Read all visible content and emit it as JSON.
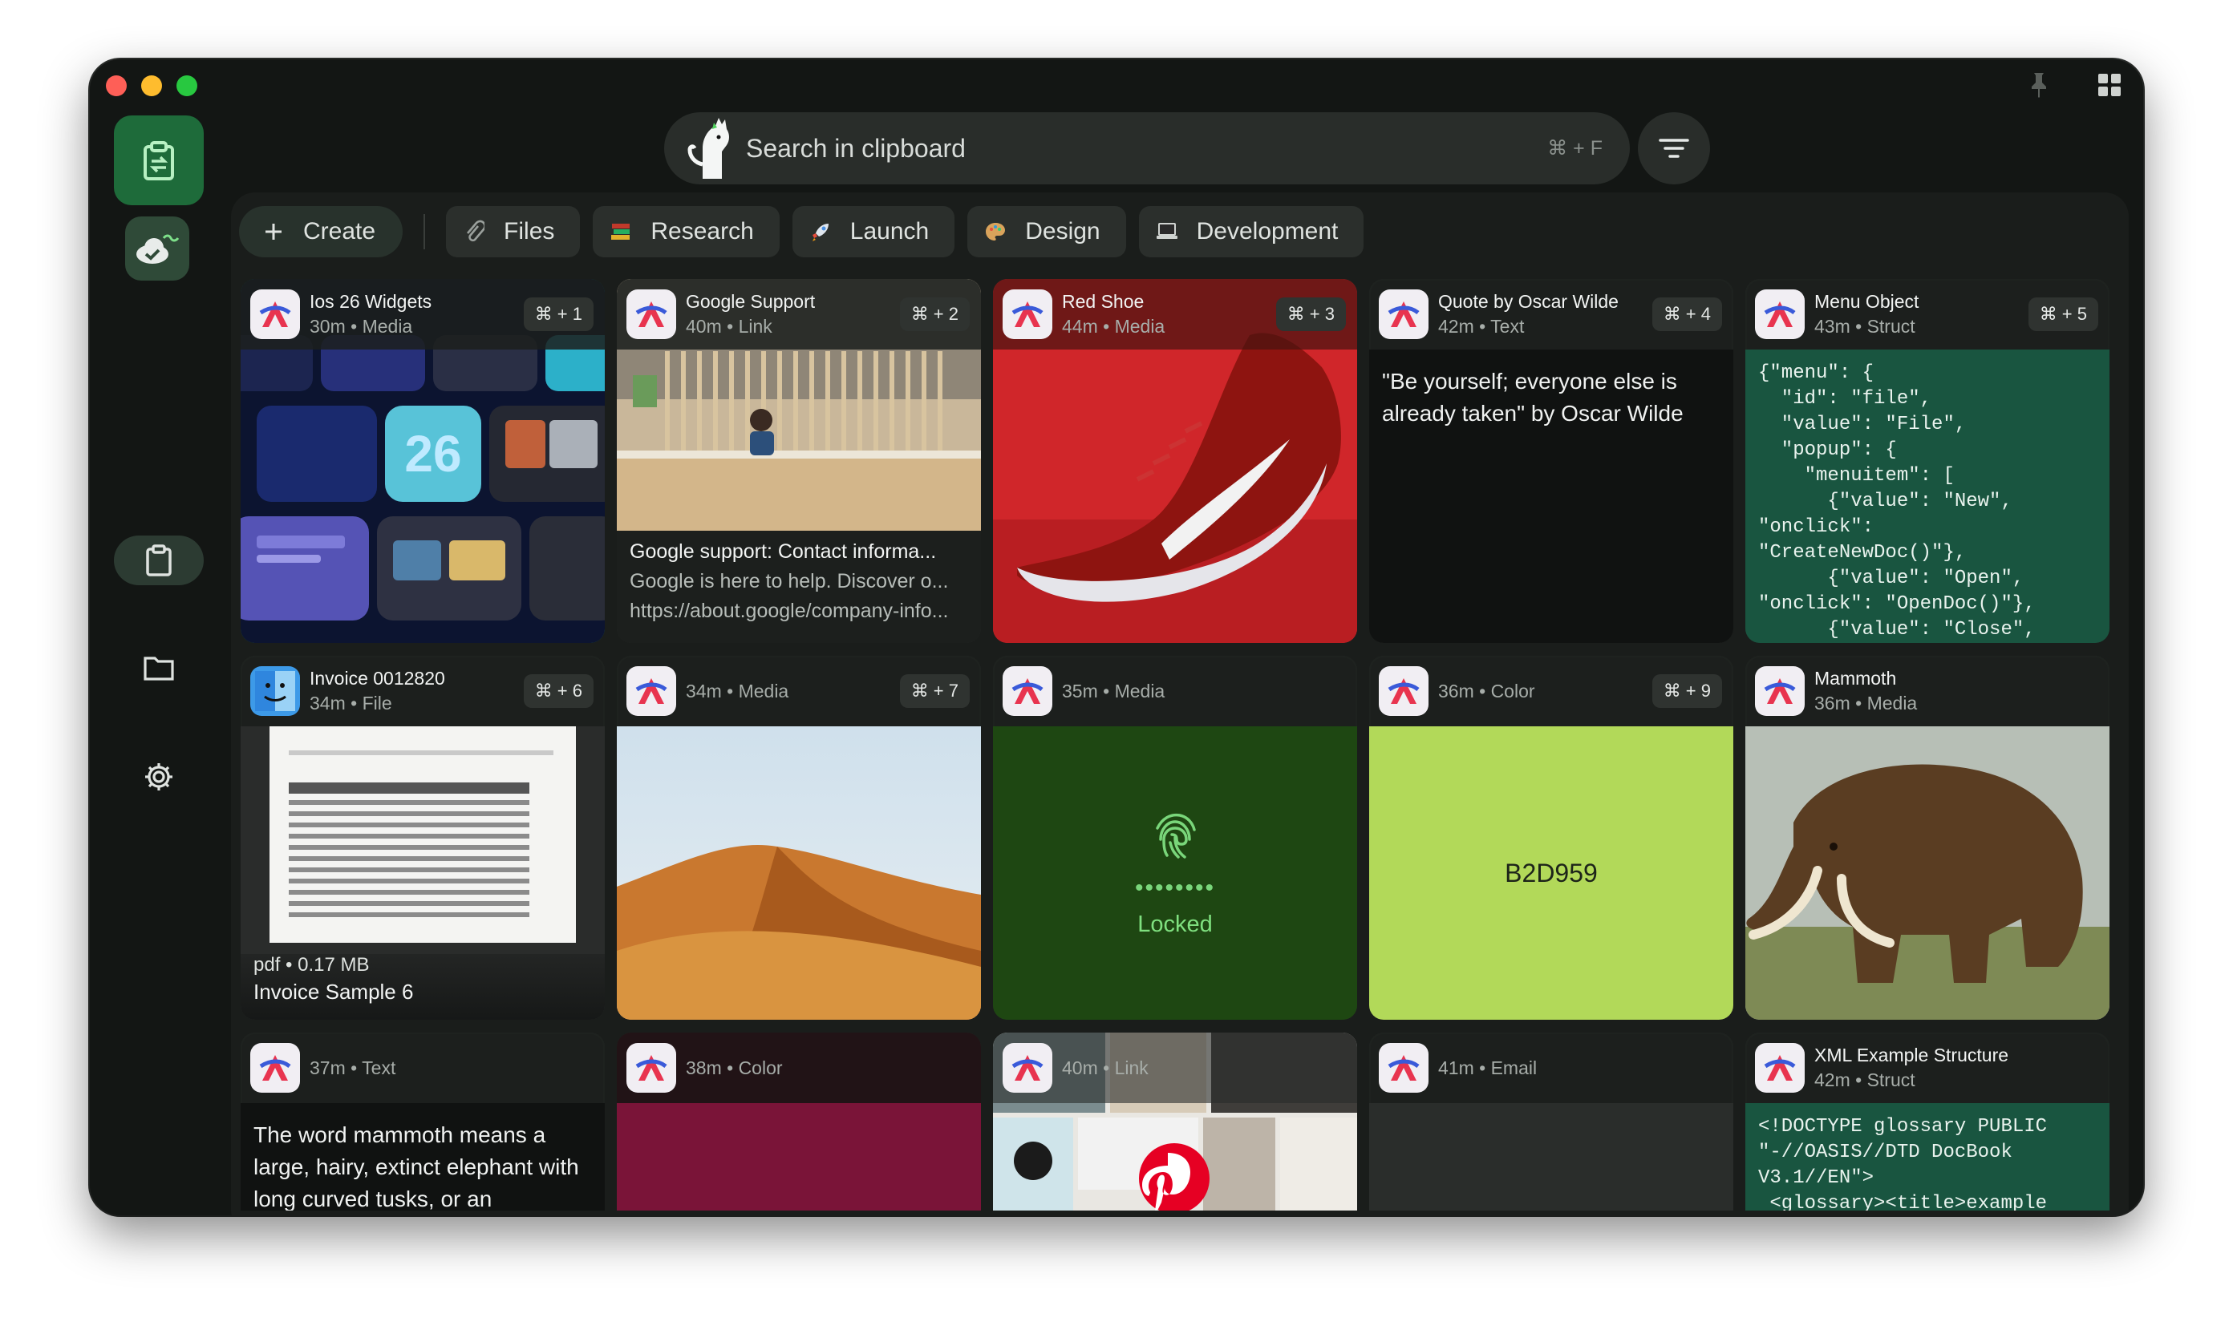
{
  "search": {
    "placeholder": "Search in clipboard",
    "shortcut": "⌘ + F"
  },
  "chips": [
    {
      "label": "Create",
      "icon": "plus-icon"
    },
    {
      "label": "Files",
      "icon": "paperclip-icon"
    },
    {
      "label": "Research",
      "icon": "books-icon"
    },
    {
      "label": "Launch",
      "icon": "rocket-icon"
    },
    {
      "label": "Design",
      "icon": "palette-icon"
    },
    {
      "label": "Development",
      "icon": "laptop-icon"
    }
  ],
  "cards": [
    {
      "title": "Ios 26 Widgets",
      "meta": "30m • Media",
      "shortcut": "⌘ + 1"
    },
    {
      "title": "Google Support",
      "meta": "40m • Link",
      "shortcut": "⌘ + 2",
      "link_title": "Google support: Contact informa...",
      "link_desc": "Google is here to help. Discover o...",
      "link_url": "https://about.google/company-info..."
    },
    {
      "title": "Red Shoe",
      "meta": "44m • Media",
      "shortcut": "⌘ + 3"
    },
    {
      "title": "Quote by Oscar Wilde",
      "meta": "42m • Text",
      "shortcut": "⌘ + 4",
      "text": "\"Be yourself; everyone else is already taken\" by Oscar Wilde"
    },
    {
      "title": "Menu Object",
      "meta": "43m • Struct",
      "shortcut": "⌘ + 5",
      "code": "{\"menu\": {\n  \"id\": \"file\",\n  \"value\": \"File\",\n  \"popup\": {\n    \"menuitem\": [\n      {\"value\": \"New\",\n\"onclick\":\n\"CreateNewDoc()\"},\n      {\"value\": \"Open\",\n\"onclick\": \"OpenDoc()\"},\n      {\"value\": \"Close\","
    },
    {
      "title": "Invoice 0012820",
      "meta": "34m • File",
      "shortcut": "⌘ + 6",
      "file_meta": "pdf • 0.17 MB",
      "file_name": "Invoice Sample 6"
    },
    {
      "title": "",
      "meta": "34m • Media",
      "shortcut": "⌘ + 7"
    },
    {
      "title": "",
      "meta": "35m • Media",
      "shortcut": "",
      "locked_dots": "••••••••",
      "locked_label": "Locked"
    },
    {
      "title": "",
      "meta": "36m • Color",
      "shortcut": "⌘ + 9",
      "color_hex": "B2D959",
      "color": "#B2D959"
    },
    {
      "title": "Mammoth",
      "meta": "36m • Media",
      "shortcut": ""
    },
    {
      "title": "",
      "meta": "37m • Text",
      "shortcut": "",
      "text": "The word mammoth means a large, hairy, extinct elephant with long curved tusks, or an"
    },
    {
      "title": "",
      "meta": "38m • Color",
      "shortcut": "",
      "color": "#7A1438"
    },
    {
      "title": "",
      "meta": "40m • Link",
      "shortcut": ""
    },
    {
      "title": "",
      "meta": "41m • Email",
      "shortcut": ""
    },
    {
      "title": "XML Example Structure",
      "meta": "42m • Struct",
      "shortcut": "",
      "code": "<!DOCTYPE glossary PUBLIC\n\"-//OASIS//DTD DocBook\nV3.1//EN\">\n <glossary><title>example"
    }
  ]
}
